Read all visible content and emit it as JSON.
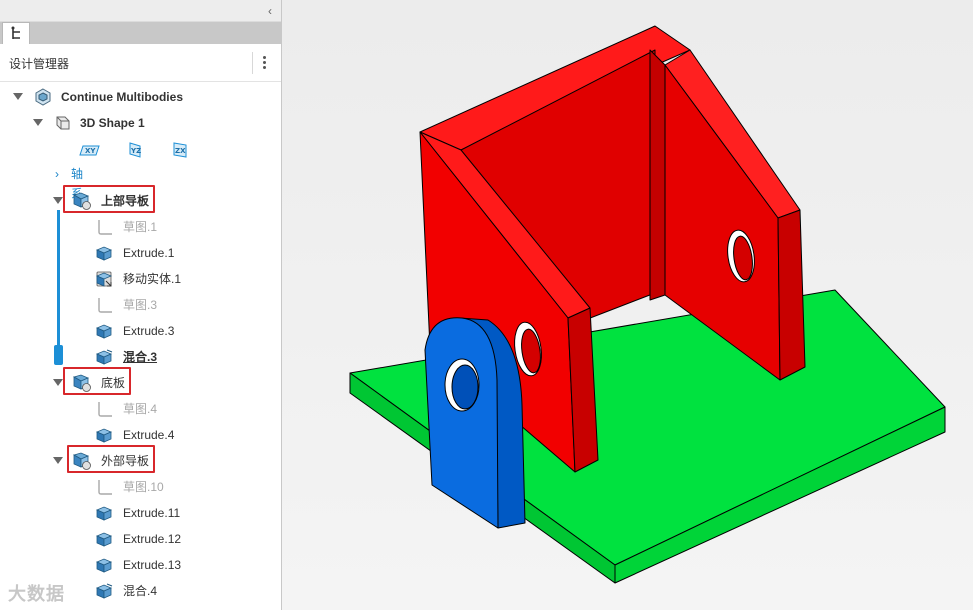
{
  "panel": {
    "title": "设计管理器",
    "collapse_glyph": "‹",
    "tabs": [
      {
        "icon": "feature-tree-icon"
      }
    ]
  },
  "tree": {
    "root": {
      "label": "Continue Multibodies",
      "icon": "multibody-icon"
    },
    "shape": {
      "label": "3D Shape 1",
      "icon": "shape-icon"
    },
    "planes": [
      "XY",
      "YZ",
      "ZX"
    ],
    "axis": {
      "label": "轴系"
    },
    "groups": [
      {
        "label": "上部导板",
        "items": [
          {
            "label": "草图.1",
            "state": "suppressed",
            "icon": "sketch-icon"
          },
          {
            "label": "Extrude.1",
            "state": "normal",
            "icon": "extrude-icon"
          },
          {
            "label": "移动实体.1",
            "state": "normal",
            "icon": "move-body-icon"
          },
          {
            "label": "草图.3",
            "state": "suppressed",
            "icon": "sketch-icon"
          },
          {
            "label": "Extrude.3",
            "state": "normal",
            "icon": "extrude-icon"
          },
          {
            "label": "混合.3",
            "state": "current",
            "icon": "blend-icon"
          }
        ]
      },
      {
        "label": "底板",
        "items": [
          {
            "label": "草图.4",
            "state": "suppressed",
            "icon": "sketch-icon"
          },
          {
            "label": "Extrude.4",
            "state": "normal",
            "icon": "extrude-icon"
          }
        ]
      },
      {
        "label": "外部导板",
        "items": [
          {
            "label": "草图.10",
            "state": "suppressed",
            "icon": "sketch-icon"
          },
          {
            "label": "Extrude.11",
            "state": "normal",
            "icon": "extrude-icon"
          },
          {
            "label": "Extrude.12",
            "state": "normal",
            "icon": "extrude-icon"
          },
          {
            "label": "Extrude.13",
            "state": "normal",
            "icon": "extrude-icon"
          },
          {
            "label": "混合.4",
            "state": "normal",
            "icon": "blend-icon"
          }
        ]
      }
    ]
  },
  "watermark": "大数据",
  "colors": {
    "accent": "#1c8fd6",
    "highlight_box": "#d8272b",
    "body_red": "#ff0000",
    "body_green": "#00e040",
    "body_blue": "#0066d6"
  }
}
